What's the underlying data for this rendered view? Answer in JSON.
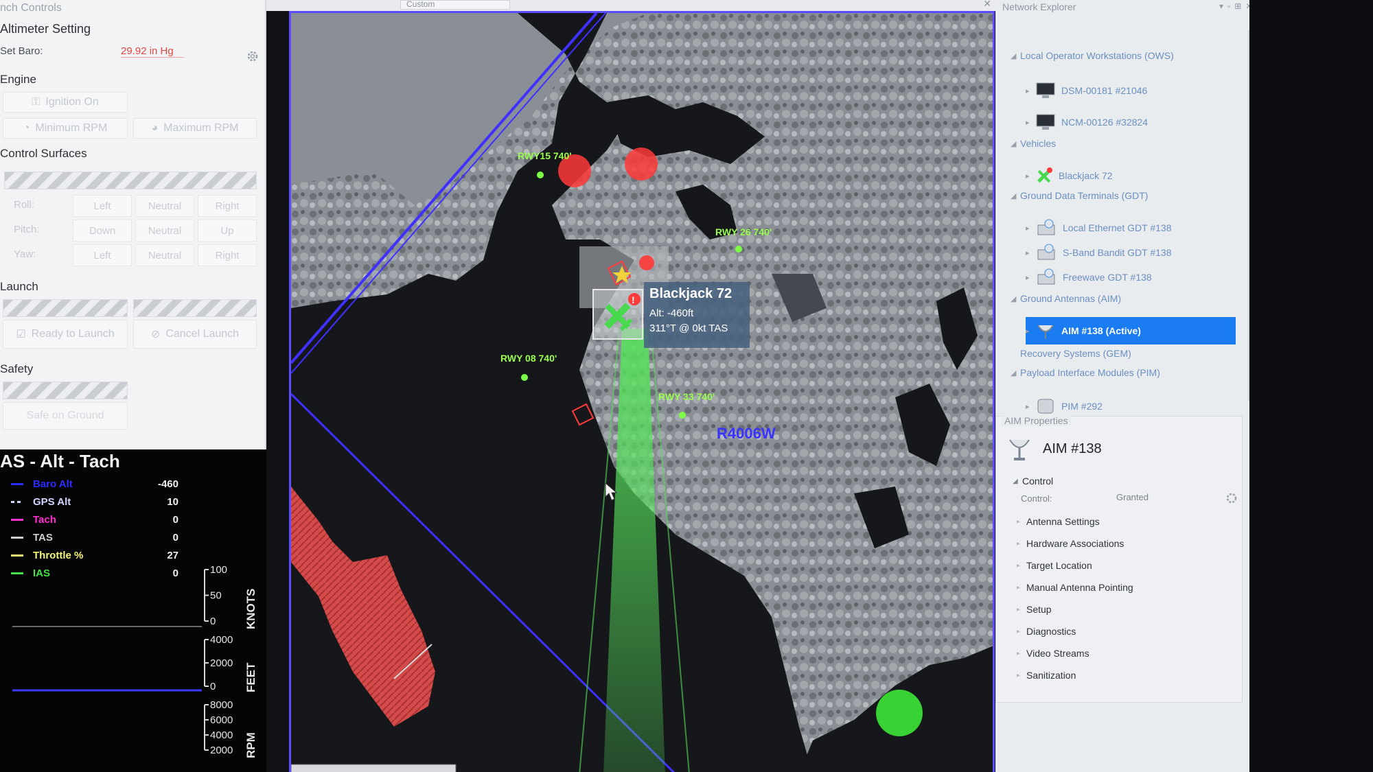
{
  "left_panel": {
    "title": "nch Controls",
    "altimeter": {
      "heading": "Altimeter Setting",
      "set_baro_label": "Set Baro:",
      "set_baro_value": "29.92 in Hg"
    },
    "engine": {
      "heading": "Engine",
      "ignition": "Ignition On",
      "min_rpm": "Minimum RPM",
      "max_rpm": "Maximum RPM"
    },
    "control_surfaces": {
      "heading": "Control Surfaces",
      "rows": [
        {
          "label": "Roll:",
          "cells": [
            "Left",
            "Neutral",
            "Right"
          ]
        },
        {
          "label": "Pitch:",
          "cells": [
            "Down",
            "Neutral",
            "Up"
          ]
        },
        {
          "label": "Yaw:",
          "cells": [
            "Left",
            "Neutral",
            "Right"
          ]
        }
      ]
    },
    "launch": {
      "heading": "Launch",
      "ready": "Ready to Launch",
      "cancel": "Cancel Launch"
    },
    "safety": {
      "heading": "Safety",
      "button": "Safe on Ground"
    }
  },
  "chart_data": {
    "type": "line",
    "title": "AS - Alt - Tach",
    "series": [
      {
        "name": "Baro Alt",
        "value": "-460",
        "color": "#2b2bff",
        "style": "solid"
      },
      {
        "name": "GPS Alt",
        "value": "10",
        "color": "#cfd6ff",
        "style": "dashed"
      },
      {
        "name": "Tach",
        "value": "0",
        "color": "#ff2fd0",
        "style": "solid"
      },
      {
        "name": "TAS",
        "value": "0",
        "color": "#cfcfcf",
        "style": "solid"
      },
      {
        "name": "Throttle %",
        "value": "27",
        "color": "#f7f77a",
        "style": "solid"
      },
      {
        "name": "IAS",
        "value": "0",
        "color": "#46e04a",
        "style": "solid"
      }
    ],
    "axes": [
      {
        "unit": "KNOTS",
        "ticks": [
          "100",
          "50",
          "0"
        ],
        "ylim": [
          0,
          100
        ]
      },
      {
        "unit": "FEET",
        "ticks": [
          "4000",
          "2000",
          "0"
        ],
        "ylim": [
          0,
          4000
        ]
      },
      {
        "unit": "RPM",
        "ticks": [
          "8000",
          "6000",
          "4000",
          "2000"
        ],
        "ylim": [
          2000,
          8000
        ]
      }
    ],
    "traces": [
      {
        "axis": 0,
        "name": "IAS",
        "color": "#8a8a8a",
        "values": [
          0,
          0
        ]
      },
      {
        "axis": 1,
        "name": "Baro Alt",
        "color": "#3b3bff",
        "values": [
          0,
          0
        ]
      }
    ]
  },
  "map": {
    "tab_label": "Custom",
    "runways": [
      {
        "label": "RWY15 740'"
      },
      {
        "label": "RWY 26 740'"
      },
      {
        "label": "RWY 08 740'"
      },
      {
        "label": "RWY 33 740'"
      }
    ],
    "region_label": "R4006W",
    "vehicle_tooltip": {
      "name": "Blackjack 72",
      "alt": "Alt: -460ft",
      "heading": "311°T @ 0kt TAS"
    },
    "alert_badge": "!",
    "colors": {
      "boundary": "#3f30ff",
      "restricted": "#ff3a3a",
      "runway": "#7dff45",
      "beam": "#44d94e"
    }
  },
  "network_explorer": {
    "title": "Network Explorer",
    "tree": [
      {
        "label": "Local Operator Workstations (OWS)",
        "level": 0,
        "icon": "folder-caret"
      },
      {
        "label": "DSM-00181 #21046",
        "level": 2,
        "icon": "monitor-icon"
      },
      {
        "label": "NCM-00126 #32824",
        "level": 2,
        "icon": "monitor-icon"
      },
      {
        "label": "Vehicles",
        "level": 0,
        "icon": "folder-caret"
      },
      {
        "label": "Blackjack 72",
        "level": 2,
        "icon": "aircraft-icon"
      },
      {
        "label": "Ground Data Terminals (GDT)",
        "level": 0,
        "icon": "folder-caret"
      },
      {
        "label": "Local Ethernet GDT #138",
        "level": 2,
        "icon": "terminal-icon"
      },
      {
        "label": "S-Band Bandit GDT #138",
        "level": 2,
        "icon": "terminal-icon"
      },
      {
        "label": "Freewave GDT #138",
        "level": 2,
        "icon": "terminal-icon"
      },
      {
        "label": "Ground Antennas (AIM)",
        "level": 0,
        "icon": "folder-caret"
      },
      {
        "label": "AIM  #138 (Active)",
        "level": 2,
        "icon": "antenna-icon",
        "selected": true
      },
      {
        "label": "Recovery Systems (GEM)",
        "level": 0,
        "icon": "none"
      },
      {
        "label": "Payload Interface Modules (PIM)",
        "level": 0,
        "icon": "folder-caret"
      },
      {
        "label": "PIM #292",
        "level": 2,
        "icon": "module-icon"
      }
    ]
  },
  "aim_properties": {
    "title": "AIM Properties",
    "name": "AIM #138",
    "control_heading": "Control",
    "control_label": "Control:",
    "control_value": "Granted",
    "sections": [
      "Antenna Settings",
      "Hardware Associations",
      "Target Location",
      "Manual Antenna Pointing",
      "Setup",
      "Diagnostics",
      "Video Streams",
      "Sanitization"
    ]
  }
}
